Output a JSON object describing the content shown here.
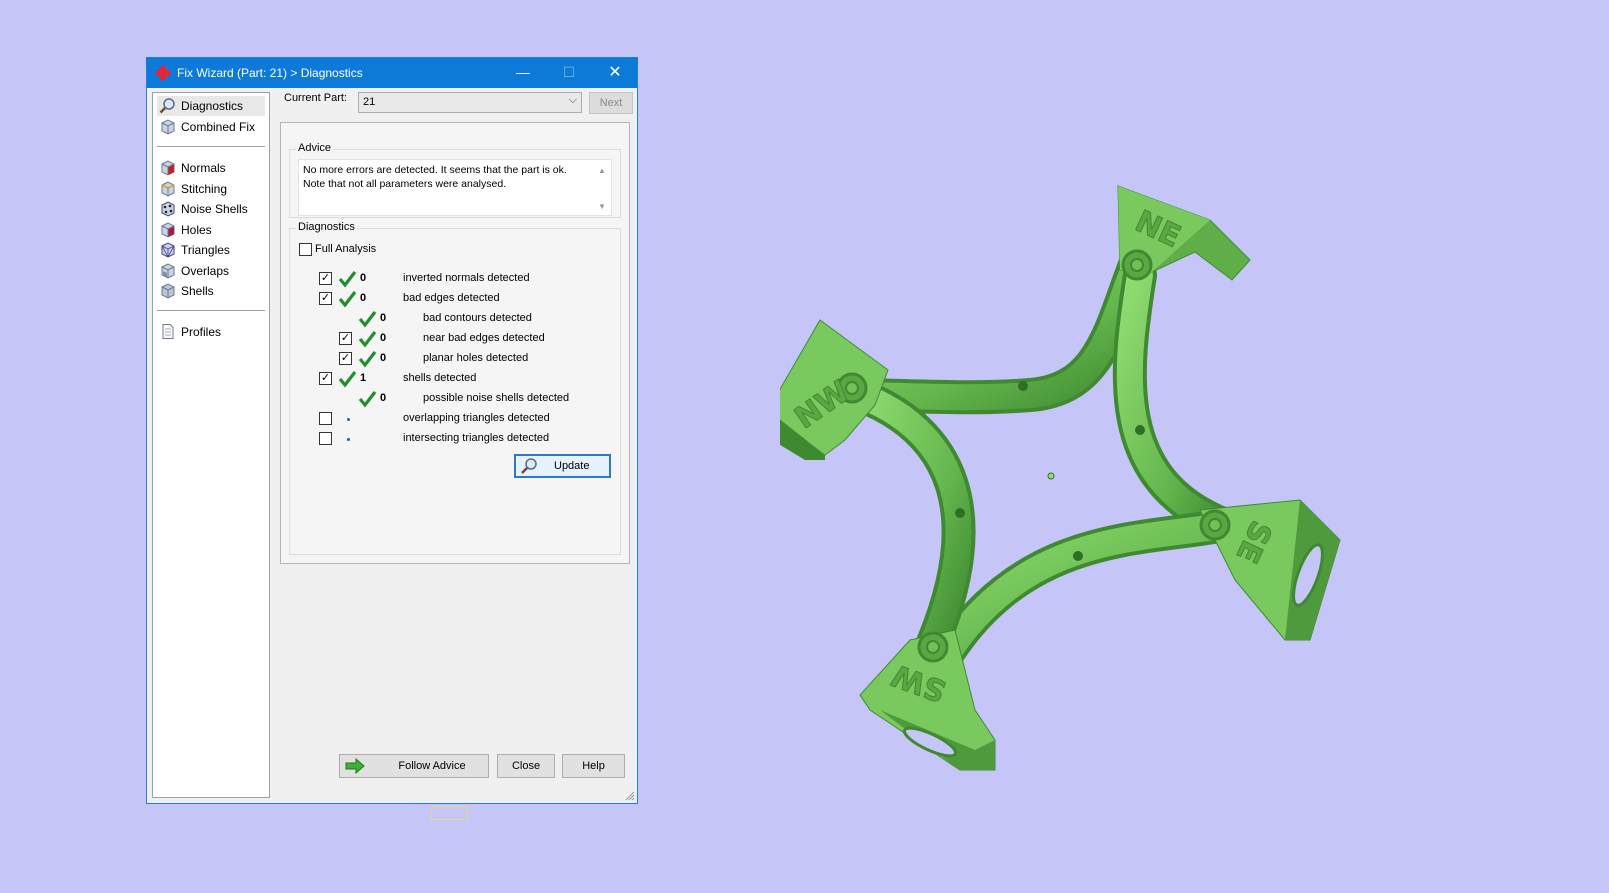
{
  "window": {
    "title": "Fix Wizard (Part: 21) > Diagnostics",
    "minimize_glyph": "—",
    "maximize_glyph": "☐",
    "close_glyph": "✕"
  },
  "nav": {
    "items": [
      {
        "label": "Diagnostics",
        "icon": "magnifier-icon",
        "selected": true
      },
      {
        "label": "Combined Fix",
        "icon": "cube-icon"
      },
      {
        "label": "Normals",
        "icon": "normals-cube-icon"
      },
      {
        "label": "Stitching",
        "icon": "stitching-cube-icon"
      },
      {
        "label": "Noise Shells",
        "icon": "noise-shells-icon"
      },
      {
        "label": "Holes",
        "icon": "holes-cube-icon"
      },
      {
        "label": "Triangles",
        "icon": "triangles-cube-icon"
      },
      {
        "label": "Overlaps",
        "icon": "overlaps-cube-icon"
      },
      {
        "label": "Shells",
        "icon": "shells-cube-icon"
      },
      {
        "label": "Profiles",
        "icon": "document-icon"
      }
    ]
  },
  "current_part": {
    "label": "Current Part:",
    "value": "21",
    "next_label": "Next"
  },
  "advice": {
    "title": "Advice",
    "line1": "No more errors are detected. It seems that the part is ok.",
    "line2": "Note that not all parameters were analysed."
  },
  "diagnostics": {
    "title": "Diagnostics",
    "full_analysis_label": "Full Analysis",
    "full_analysis_checked": false,
    "rows": [
      {
        "checkbox": true,
        "checked": true,
        "status": "ok",
        "count": "0",
        "text": "inverted normals detected",
        "indent": 0
      },
      {
        "checkbox": true,
        "checked": true,
        "status": "ok",
        "count": "0",
        "text": "bad edges detected",
        "indent": 0
      },
      {
        "checkbox": false,
        "status": "ok",
        "count": "0",
        "text": "bad contours detected",
        "indent": 1
      },
      {
        "checkbox": true,
        "checked": true,
        "status": "ok",
        "count": "0",
        "text": "near bad edges detected",
        "indent": 1
      },
      {
        "checkbox": true,
        "checked": true,
        "status": "ok",
        "count": "0",
        "text": "planar holes detected",
        "indent": 1
      },
      {
        "checkbox": true,
        "checked": true,
        "status": "ok",
        "count": "1",
        "text": "shells detected",
        "indent": 0
      },
      {
        "checkbox": false,
        "status": "ok",
        "count": "0",
        "text": "possible noise shells detected",
        "indent": 1
      },
      {
        "checkbox": true,
        "checked": false,
        "status": "not-run",
        "count": "",
        "text": "overlapping triangles detected",
        "indent": 0
      },
      {
        "checkbox": true,
        "checked": false,
        "status": "not-run",
        "count": "",
        "text": "intersecting triangles detected",
        "indent": 0
      }
    ],
    "update_label": "Update"
  },
  "buttons": {
    "follow_advice": "Follow Advice",
    "close": "Close",
    "help": "Help"
  },
  "viewport": {
    "model_labels": [
      "NE",
      "NW",
      "SE",
      "SW"
    ],
    "model_color": "#6fc257",
    "background": "#c5c5f8"
  },
  "colors": {
    "titlebar": "#0d7ad8",
    "check_green": "#1f8f2b",
    "focus_blue": "#2f78c6"
  }
}
